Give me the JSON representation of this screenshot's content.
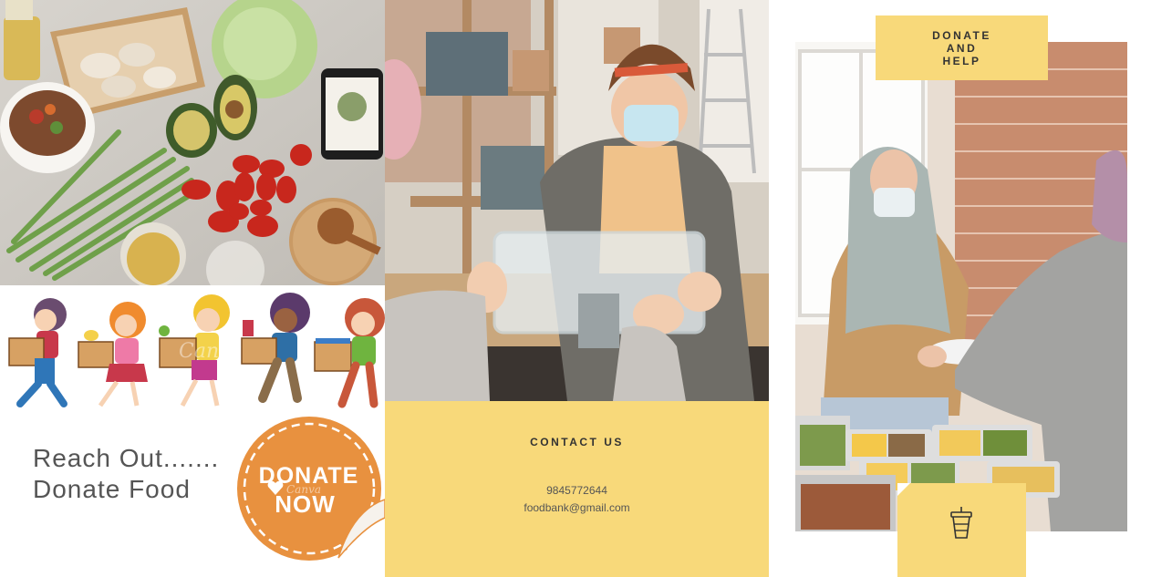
{
  "left_panel": {
    "headline_line1": "Reach Out.......",
    "headline_line2": "Donate Food",
    "badge": {
      "line1": "DONATE",
      "line2": "NOW",
      "watermark": "Canva",
      "color": "#e8913f"
    },
    "kids_watermark": "Canva"
  },
  "middle_panel": {
    "contact": {
      "title": "CONTACT US",
      "phone": "9845772644",
      "email": "foodbank@gmail.com"
    }
  },
  "right_panel": {
    "donate_help": {
      "line1": "DONATE",
      "line2": "AND",
      "line3": "HELP"
    },
    "cup_icon": "drink-cup-icon"
  },
  "colors": {
    "accent_yellow": "#f8d97a",
    "badge_orange": "#e8913f",
    "text_dark": "#333333",
    "text_gray": "#555555"
  }
}
